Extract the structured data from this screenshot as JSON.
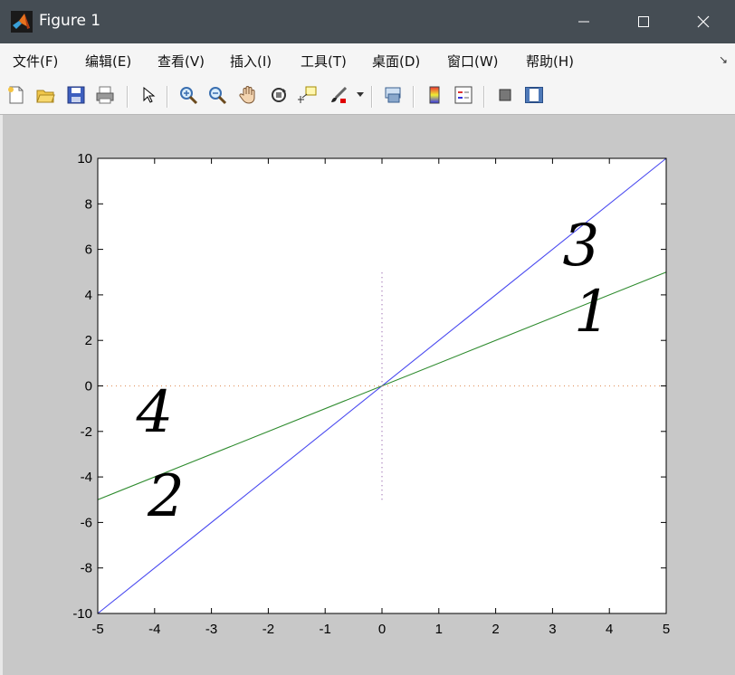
{
  "window": {
    "title": "Figure 1",
    "minimize_glyph": "—",
    "maximize_glyph": "☐",
    "close_glyph": "✕"
  },
  "menu": {
    "items": [
      "文件(F)",
      "编辑(E)",
      "查看(V)",
      "插入(I)",
      "工具(T)",
      "桌面(D)",
      "窗口(W)",
      "帮助(H)"
    ],
    "overflow_glyph": "↘"
  },
  "toolbar": {
    "icons": [
      "new-figure-icon",
      "open-file-icon",
      "save-icon",
      "print-icon",
      "edit-plot-arrow-icon",
      "zoom-in-icon",
      "zoom-out-icon",
      "pan-hand-icon",
      "rotate-3d-icon",
      "data-cursor-icon",
      "brush-icon",
      "brush-dropdown-icon",
      "link-plot-icon",
      "insert-colorbar-icon",
      "insert-legend-icon",
      "hide-plot-tools-icon",
      "show-plot-tools-icon"
    ]
  },
  "chart_data": {
    "type": "line",
    "title": "",
    "xlabel": "",
    "ylabel": "",
    "xlim": [
      -5,
      5
    ],
    "ylim": [
      -10,
      10
    ],
    "xticks": [
      -5,
      -4,
      -3,
      -2,
      -1,
      0,
      1,
      2,
      3,
      4,
      5
    ],
    "yticks": [
      -10,
      -8,
      -6,
      -4,
      -2,
      0,
      2,
      4,
      6,
      8,
      10
    ],
    "grid": false,
    "series": [
      {
        "color": "#4a4af0",
        "style": "solid",
        "x": [
          -5,
          5
        ],
        "y": [
          -10,
          10
        ]
      },
      {
        "color": "#2e8b2e",
        "style": "solid",
        "x": [
          -5,
          5
        ],
        "y": [
          -5,
          5
        ]
      },
      {
        "color": "#e39a6a",
        "style": "dotted",
        "x": [
          -5,
          5
        ],
        "y": [
          0,
          0
        ]
      },
      {
        "color": "#9a6ab0",
        "style": "dotted",
        "x": [
          0,
          0
        ],
        "y": [
          -5,
          5
        ]
      }
    ],
    "annotations": [
      {
        "text": "1",
        "x": 3.7,
        "y": 2.4
      },
      {
        "text": "2",
        "x": -3.8,
        "y": -5.7
      },
      {
        "text": "3",
        "x": 3.5,
        "y": 5.3
      },
      {
        "text": "4",
        "x": -4.0,
        "y": -2.0
      }
    ]
  }
}
